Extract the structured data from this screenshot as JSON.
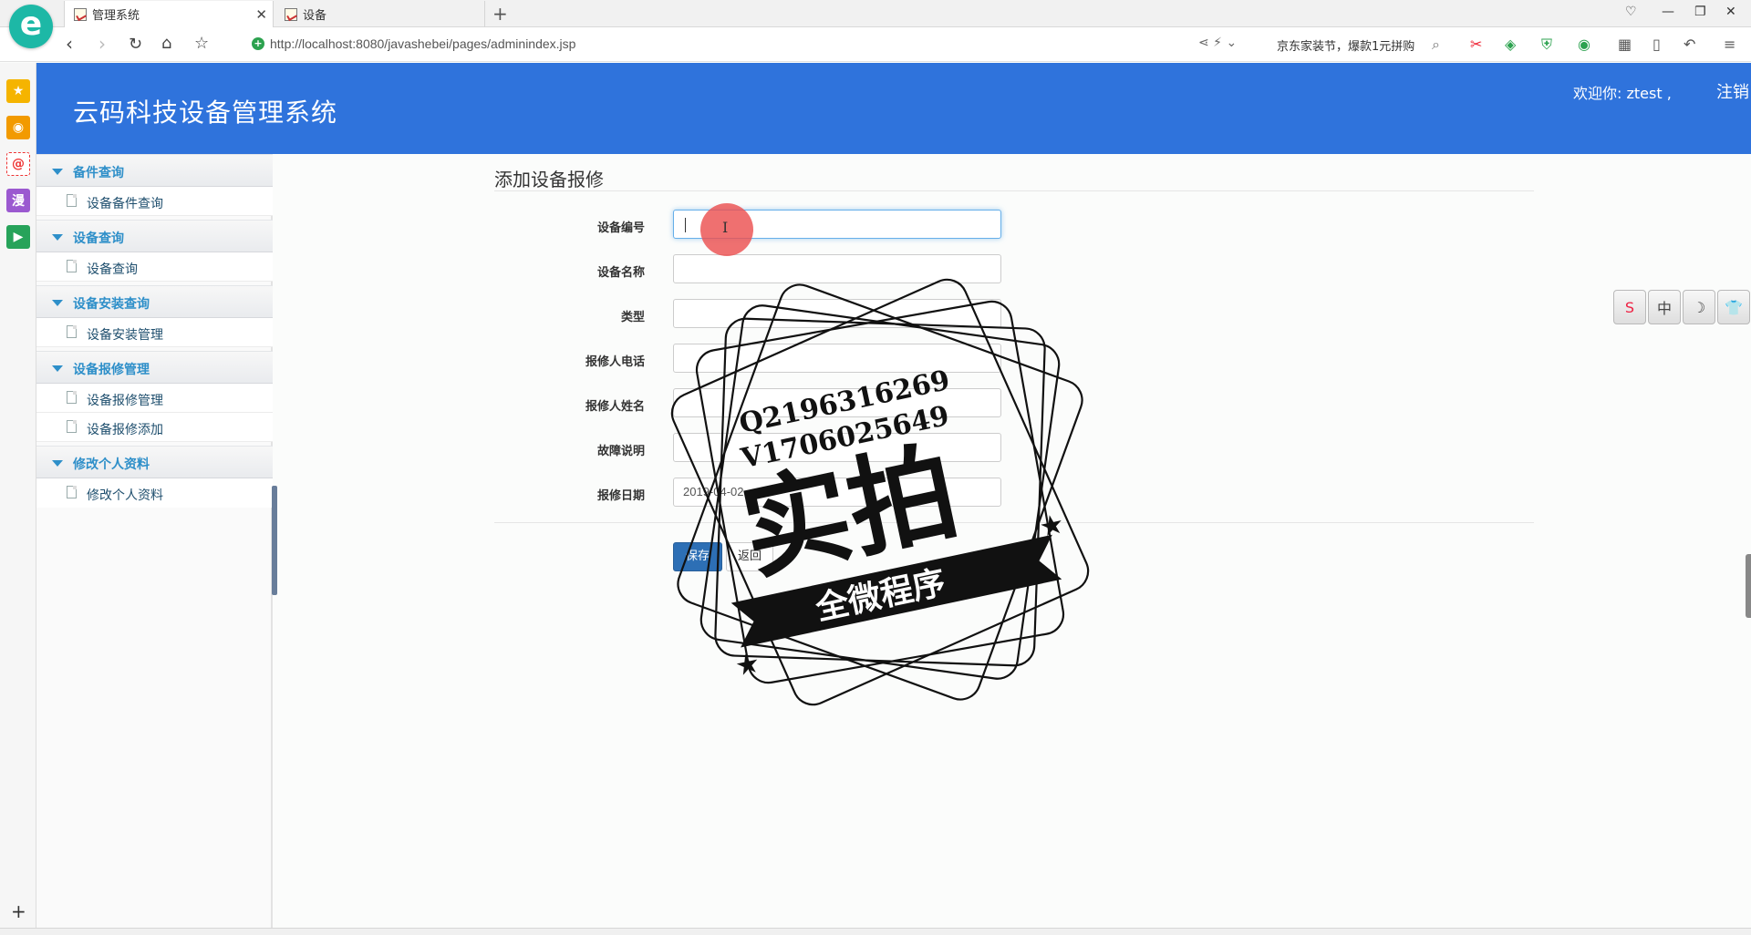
{
  "browser": {
    "tabs": [
      {
        "label": "管理系统"
      },
      {
        "label": "设备"
      }
    ],
    "url": "http://localhost:8080/javashebei/pages/adminindex.jsp",
    "ad_text": "京东家装节，爆款1元拼购"
  },
  "header": {
    "title": "云码科技设备管理系统",
    "welcome": "欢迎你: ztest ,",
    "logout": "注销"
  },
  "sidebar": {
    "groups": [
      {
        "label": "备件查询",
        "items": [
          "设备备件查询"
        ]
      },
      {
        "label": "设备查询",
        "items": [
          "设备查询"
        ]
      },
      {
        "label": "设备安装查询",
        "items": [
          "设备安装管理"
        ]
      },
      {
        "label": "设备报修管理",
        "items": [
          "设备报修管理",
          "设备报修添加"
        ]
      },
      {
        "label": "修改个人资料",
        "items": [
          "修改个人资料"
        ]
      }
    ]
  },
  "form": {
    "title": "添加设备报修",
    "fields": [
      {
        "label": "设备编号",
        "value": ""
      },
      {
        "label": "设备名称",
        "value": ""
      },
      {
        "label": "类型",
        "value": ""
      },
      {
        "label": "报修人电话",
        "value": ""
      },
      {
        "label": "报修人姓名",
        "value": ""
      },
      {
        "label": "故障说明",
        "value": ""
      },
      {
        "label": "报修日期",
        "value": "2019-04-02"
      }
    ],
    "save_label": "保存",
    "back_label": "返回"
  },
  "float_tools": [
    "S",
    "中",
    "☽",
    "👕"
  ],
  "watermark": {
    "line1": "Q2196316269",
    "line2": "V1706025649",
    "big": "实拍",
    "banner": "全微程序"
  }
}
